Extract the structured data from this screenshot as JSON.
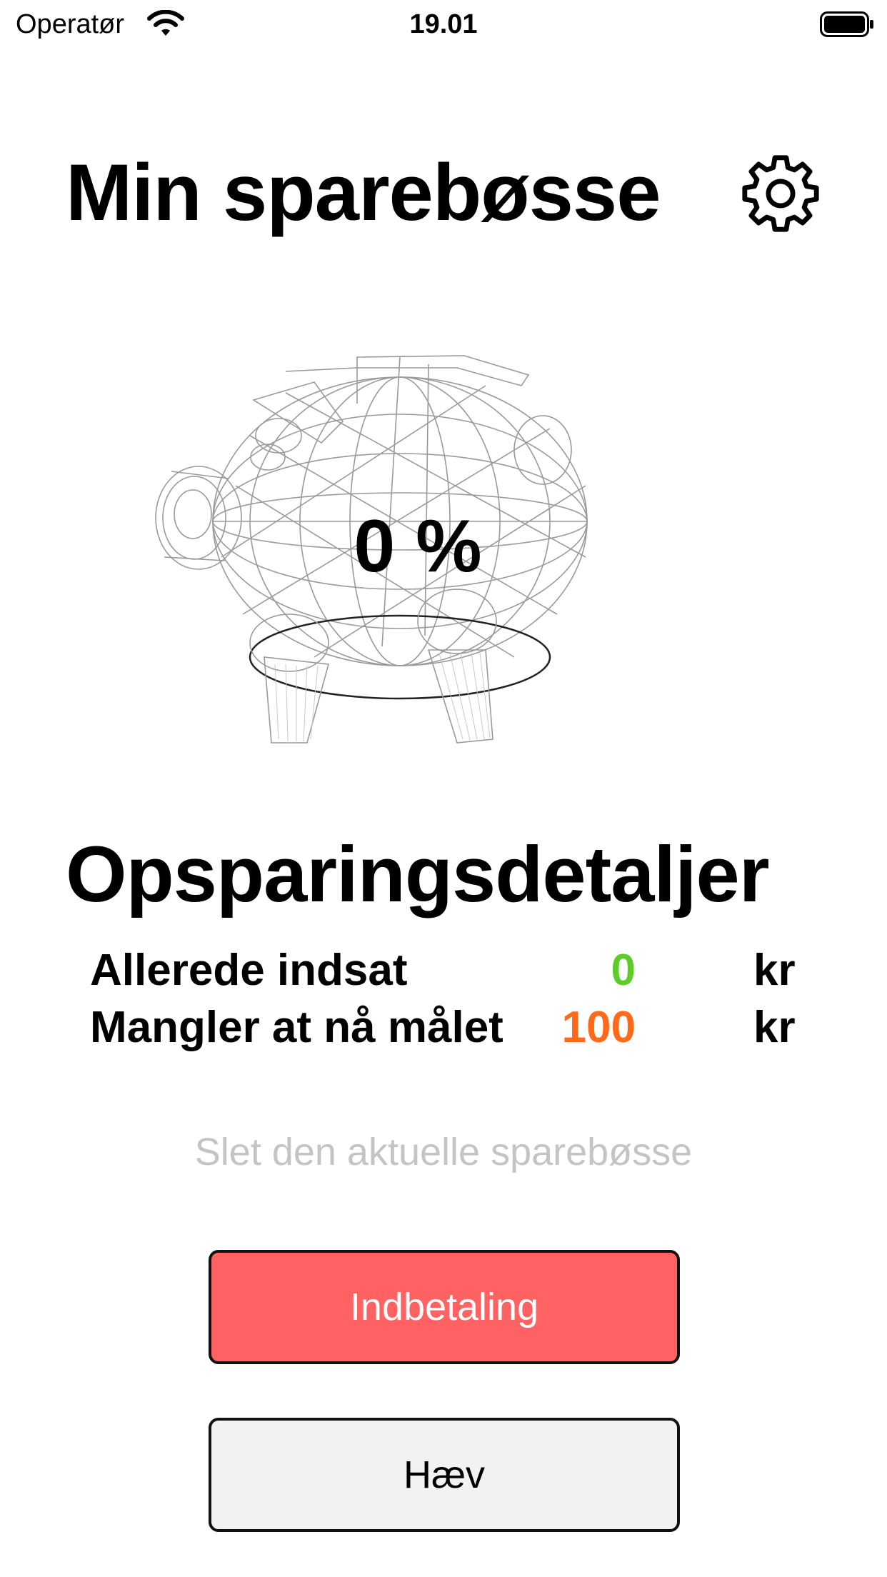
{
  "status_bar": {
    "carrier": "Operatør",
    "time": "19.01"
  },
  "header": {
    "title": "Min sparebøsse",
    "settings_icon": "gear-icon"
  },
  "piggy": {
    "percent": "0 %",
    "icon": "piggy-bank-wireframe"
  },
  "details": {
    "heading": "Opsparingsdetaljer",
    "rows": [
      {
        "label": "Allerede indsat",
        "value": "0",
        "unit": "kr",
        "color": "#5ecb2a"
      },
      {
        "label": "Mangler at nå målet",
        "value": "100",
        "unit": "kr",
        "color": "#ff6a1a"
      }
    ]
  },
  "actions": {
    "delete_label": "Slet den aktuelle sparebøsse",
    "deposit_label": "Indbetaling",
    "withdraw_label": "Hæv",
    "deposit_color": "#ff6262"
  }
}
